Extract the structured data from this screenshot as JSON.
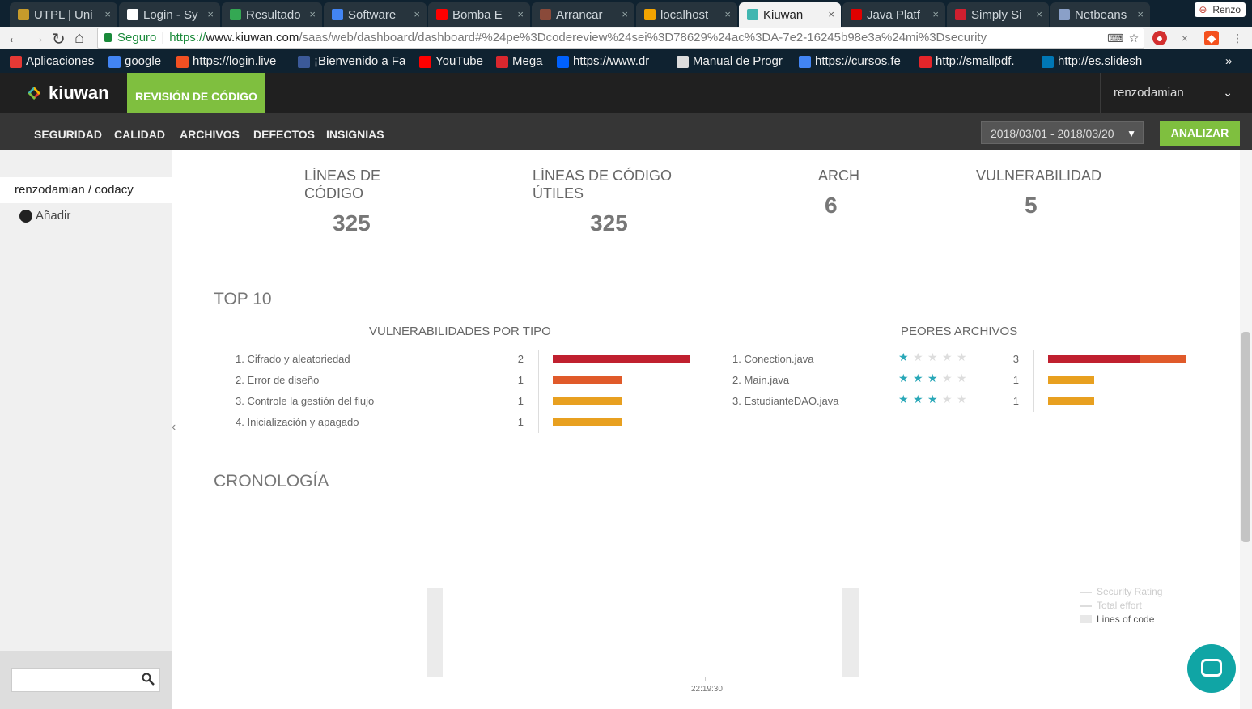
{
  "browser": {
    "tabs": [
      {
        "title": "UTPL | Uni",
        "color": "#c79b2b"
      },
      {
        "title": "Login - Sy",
        "color": "#ffffff"
      },
      {
        "title": "Resultado",
        "color": "#34a853"
      },
      {
        "title": "Software",
        "color": "#4285f4"
      },
      {
        "title": "Bomba E",
        "color": "#ff0000"
      },
      {
        "title": "Arrancar",
        "color": "#8a4a3a"
      },
      {
        "title": "localhost",
        "color": "#f4a400"
      },
      {
        "title": "Kiuwan",
        "color": "#3fb6b0"
      },
      {
        "title": "Java Platf",
        "color": "#e00000"
      },
      {
        "title": "Simply Si",
        "color": "#d01f2f"
      },
      {
        "title": "Netbeans",
        "color": "#8aa0c8"
      }
    ],
    "profile": "Renzo",
    "url": {
      "secure_label": "Seguro",
      "scheme": "https://",
      "host": "www.kiuwan.com",
      "path": "/saas/web/dashboard/dashboard#%24pe%3Dcodereview%24sei%3D78629%24ac%3DA-7e2-16245b98e3a%24mi%3Dsecurity"
    },
    "bookmarks": [
      {
        "label": "Aplicaciones",
        "color": "#e53935"
      },
      {
        "label": "google",
        "color": "#4285f4"
      },
      {
        "label": "https://login.live",
        "color": "#f25022"
      },
      {
        "label": "¡Bienvenido a Fa",
        "color": "#3b5998"
      },
      {
        "label": "YouTube",
        "color": "#ff0000"
      },
      {
        "label": "Mega",
        "color": "#d9272e"
      },
      {
        "label": "https://www.dr",
        "color": "#0061fe"
      },
      {
        "label": "Manual de Progr",
        "color": "#dddddd"
      },
      {
        "label": "https://cursos.fe",
        "color": "#4285f4"
      },
      {
        "label": "http://smallpdf.",
        "color": "#e5252a"
      },
      {
        "label": "http://es.slidesh",
        "color": "#0077b5"
      }
    ],
    "more": "»"
  },
  "app": {
    "logo": "kiuwan",
    "active_tab": "REVISIÓN DE CÓDIGO",
    "user": "renzodamian",
    "nav": [
      "SEGURIDAD",
      "CALIDAD",
      "ARCHIVOS",
      "DEFECTOS",
      "INSIGNIAS"
    ],
    "date_range": "2018/03/01 - 2018/03/20",
    "analyze_label": "ANALIZAR",
    "colors": {
      "accent": "#7fbf3f",
      "critical": "#c0202f",
      "high": "#e05a2a",
      "medium": "#e8a020",
      "star": "#2aa8b8"
    }
  },
  "sidebar": {
    "repo": "renzodamian / codacy",
    "add_label": "Añadir",
    "collapse": "‹"
  },
  "metrics": [
    {
      "label_lines": [
        "LÍNEAS DE",
        "CÓDIGO"
      ],
      "value": "325"
    },
    {
      "label_lines": [
        "LÍNEAS DE CÓDIGO",
        "ÚTILES"
      ],
      "value": "325"
    },
    {
      "label_lines": [
        "ARCHI"
      ],
      "value": "6"
    },
    {
      "label_lines": [
        "VULNERABILIDADI"
      ],
      "value": "5"
    }
  ],
  "top10": {
    "title": "TOP 10",
    "by_type": {
      "title": "VULNERABILIDADES POR TIPO",
      "rows": [
        {
          "label": "1. Cifrado y aleatoriedad",
          "count": "2",
          "segments": [
            {
              "value": 2,
              "color": "#c0202f"
            }
          ]
        },
        {
          "label": "2. Error de diseño",
          "count": "1",
          "segments": [
            {
              "value": 1,
              "color": "#e05a2a"
            }
          ]
        },
        {
          "label": "3. Controle la gestión del flujo",
          "count": "1",
          "segments": [
            {
              "value": 1,
              "color": "#e8a020"
            }
          ]
        },
        {
          "label": "4. Inicialización y apagado",
          "count": "1",
          "segments": [
            {
              "value": 1,
              "color": "#e8a020"
            }
          ]
        }
      ]
    },
    "worst_files": {
      "title": "PEORES ARCHIVOS",
      "rows": [
        {
          "label": "1. Conection.java",
          "stars": 1,
          "count": "3",
          "segments": [
            {
              "value": 2,
              "color": "#c0202f"
            },
            {
              "value": 1,
              "color": "#e05a2a"
            }
          ]
        },
        {
          "label": "2. Main.java",
          "stars": 3,
          "count": "1",
          "segments": [
            {
              "value": 1,
              "color": "#e8a020"
            }
          ]
        },
        {
          "label": "3. EstudianteDAO.java",
          "stars": 3,
          "count": "1",
          "segments": [
            {
              "value": 1,
              "color": "#e8a020"
            }
          ]
        }
      ]
    }
  },
  "chronology": {
    "title": "CRONOLOGÍA",
    "legend": [
      {
        "label": "Security Rating",
        "active": false
      },
      {
        "label": "Total effort",
        "active": false
      },
      {
        "label": "Lines of code",
        "active": true
      }
    ],
    "x_tick": "22:19:30"
  }
}
